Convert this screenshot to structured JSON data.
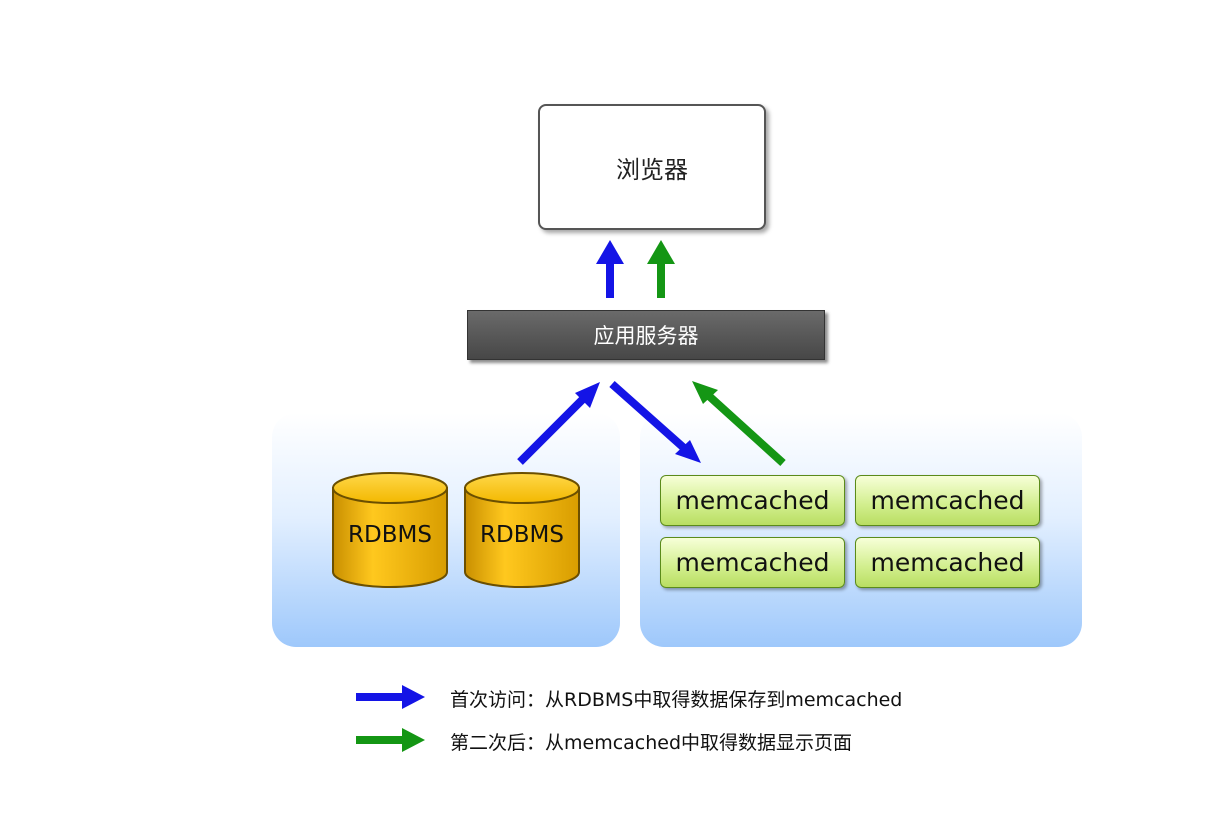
{
  "browser": {
    "label": "浏览器"
  },
  "app_server": {
    "label": "应用服务器"
  },
  "databases": [
    {
      "label": "RDBMS"
    },
    {
      "label": "RDBMS"
    }
  ],
  "memcached_nodes": [
    {
      "label": "memcached"
    },
    {
      "label": "memcached"
    },
    {
      "label": "memcached"
    },
    {
      "label": "memcached"
    }
  ],
  "legend": [
    {
      "color": "#1414e6",
      "text": "首次访问：从RDBMS中取得数据保存到memcached"
    },
    {
      "color": "#149614",
      "text": "第二次后：从memcached中取得数据显示页面"
    }
  ],
  "colors": {
    "first_access_arrow": "#1414e6",
    "second_access_arrow": "#149614",
    "database_fill": "#f0b400",
    "memcached_fill": "#d1ee8c",
    "server_fill": "#555555"
  }
}
